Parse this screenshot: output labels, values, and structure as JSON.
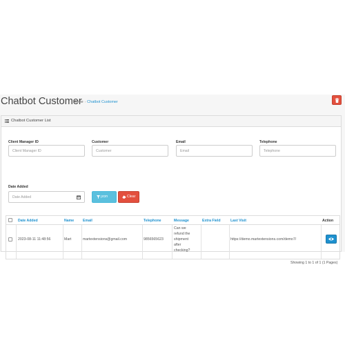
{
  "header": {
    "title": "Chatbot Customer",
    "breadcrumb": [
      {
        "label": "Home"
      },
      {
        "label": "Chatbot Customer"
      }
    ],
    "breadcrumb_separator": "›",
    "delete_icon": "trash-icon"
  },
  "panel": {
    "title": "Chatbot Customer List",
    "icon": "list-icon"
  },
  "filter": {
    "client_manager_id": {
      "label": "Client Manager ID",
      "placeholder": "Client Manager ID",
      "value": ""
    },
    "customer": {
      "label": "Customer",
      "placeholder": "Customer",
      "value": ""
    },
    "email": {
      "label": "Email",
      "placeholder": "Email",
      "value": ""
    },
    "telephone": {
      "label": "Telephone",
      "placeholder": "Telephone",
      "value": ""
    },
    "date_added": {
      "label": "Date Added",
      "placeholder": "Date Added",
      "value": ""
    },
    "filter_button": "תסנן",
    "clear_button": "Clear"
  },
  "table": {
    "columns": [
      "Date Added",
      "Name",
      "Email",
      "Telephone",
      "Message",
      "Extra Field",
      "Last Visit",
      "Action"
    ],
    "rows": [
      {
        "date_added": "2023-08-11 11:48:56",
        "name": "Mart",
        "email": "martextensions@gmail.com",
        "telephone": "9856565623",
        "message": "Can we refund the shipment after checking?",
        "extra_field": "",
        "last_visit": "https://demo.martextensions.com/demo7/",
        "action_icon": "eye-icon"
      }
    ]
  },
  "pagination": {
    "text": "Showing 1 to 1 of 1 (1 Pages)"
  },
  "colors": {
    "primary": "#1e91cf",
    "danger": "#e3503e",
    "info": "#5bc0de"
  }
}
